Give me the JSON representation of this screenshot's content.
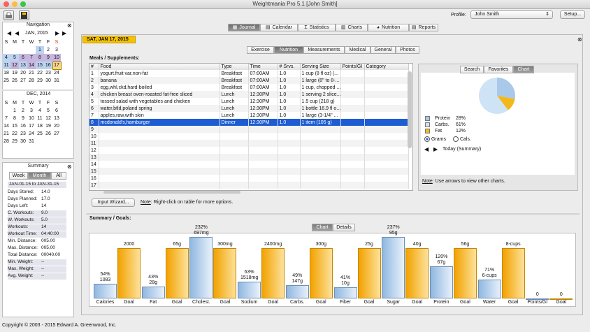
{
  "window": {
    "title": "Weightmania Pro 5.1 [John Smith]"
  },
  "profile": {
    "label": "Profile:",
    "value": "John Smith",
    "setup": "Setup..."
  },
  "nav": {
    "header": "Navigation",
    "month1": "JAN, 2015",
    "month2": "DEC, 2014",
    "weekdays": [
      "S",
      "M",
      "T",
      "W",
      "T",
      "F",
      "S"
    ],
    "jan": [
      [
        "",
        "",
        "",
        "",
        "1",
        "2",
        "3"
      ],
      [
        "4",
        "5",
        "6",
        "7",
        "8",
        "9",
        "10"
      ],
      [
        "11",
        "12",
        "13",
        "14",
        "15",
        "16",
        "17"
      ],
      [
        "18",
        "19",
        "20",
        "21",
        "22",
        "23",
        "24"
      ],
      [
        "25",
        "26",
        "27",
        "28",
        "29",
        "30",
        "31"
      ]
    ],
    "dec": [
      [
        "",
        "1",
        "2",
        "3",
        "4",
        "5",
        "6"
      ],
      [
        "7",
        "8",
        "9",
        "10",
        "11",
        "12",
        "13"
      ],
      [
        "14",
        "15",
        "16",
        "17",
        "18",
        "19",
        "20"
      ],
      [
        "21",
        "22",
        "23",
        "24",
        "25",
        "26",
        "27"
      ],
      [
        "28",
        "29",
        "30",
        "31",
        "",
        "",
        ""
      ]
    ]
  },
  "summary": {
    "header": "Summary",
    "tabs": [
      "Week",
      "Month",
      "All"
    ],
    "range": "JAN-01-15 to JAN-31-15",
    "rows": [
      [
        "Days Stored:",
        "14.0"
      ],
      [
        "Days Planned:",
        "17.0"
      ],
      [
        "Days Left:",
        "14"
      ],
      [
        "C. Workouts:",
        "9.0"
      ],
      [
        "W. Workouts:",
        "5.0"
      ],
      [
        "Workouts:",
        "14"
      ],
      [
        "Workout Time:",
        "04:40:00"
      ],
      [
        "Min. Distance:",
        "005.00"
      ],
      [
        "Max. Distance:",
        "005.00"
      ],
      [
        "Total Distance:",
        "00040.00"
      ],
      [
        "Min. Weight:",
        "--"
      ],
      [
        "Max. Weight:",
        "--"
      ],
      [
        "Avg. Weight:",
        "--"
      ]
    ]
  },
  "main_tabs": [
    "Journal",
    "Calendar",
    "Statistics",
    "Charts",
    "Nutrition",
    "Reports"
  ],
  "date": "SAT, JAN 17, 2015",
  "sub_tabs": [
    "Exercise",
    "Nutrition",
    "Measurements",
    "Medical",
    "General",
    "Photos"
  ],
  "meals": {
    "title": "Meals / Supplements:",
    "headers": [
      "#",
      "Food",
      "Type",
      "Time",
      "# Srvs.",
      "Serving Size",
      "Points/GI",
      "Category"
    ],
    "rows": [
      [
        "1",
        "yogurt,fruit var,non-fat",
        "Breakfast",
        "07:00AM",
        "1.0",
        "1 cup (8 fl oz) (...",
        ""
      ],
      [
        "2",
        "banana",
        "Breakfast",
        "07:00AM",
        "1.0",
        "1 large (8\" to 8-...",
        ""
      ],
      [
        "3",
        "egg,whl,ckd,hard-boiled",
        "Breakfast",
        "07:00AM",
        "1.0",
        "1 cup, chopped ...",
        ""
      ],
      [
        "4",
        "chicken breast oven-roasted fat-free sliced",
        "Lunch",
        "12:30PM",
        "1.0",
        "1 serving 2 slice...",
        ""
      ],
      [
        "5",
        "tossed salad with vegetables and chicken",
        "Lunch",
        "12:30PM",
        "1.0",
        "1.5 cup (218 g)",
        ""
      ],
      [
        "6",
        "water,btld,poland spring",
        "Lunch",
        "12:30PM",
        "1.0",
        "1 bottle 16.9 fl o...",
        ""
      ],
      [
        "7",
        "apples,raw,with skin",
        "Lunch",
        "12:30PM",
        "1.0",
        "1 large (3-1/4\" ...",
        ""
      ],
      [
        "8",
        "mcdonald's,hamburger",
        "Dinner",
        "12:30PM",
        "1.0",
        "1 item (105 g)",
        ""
      ]
    ],
    "empty": [
      "9",
      "10",
      "11",
      "12",
      "13",
      "14",
      "15",
      "16",
      "17"
    ]
  },
  "wizard": "Input Wizard...",
  "note": {
    "bold": "Note",
    "text": ": Right-click on table for more options."
  },
  "right_panel": {
    "tabs": [
      "Search",
      "Favorites",
      "Chart"
    ],
    "legend": [
      {
        "label": "Protein",
        "value": "28%",
        "color": "#a9c8ea"
      },
      {
        "label": "Carbs.",
        "value": "61%",
        "color": "#cfe3f6"
      },
      {
        "label": "Fat",
        "value": "12%",
        "color": "#f3b81c"
      }
    ],
    "radio": [
      "Grams",
      "Cals."
    ],
    "nav_label": "Today (Summary)",
    "note_bold": "Note",
    "note_text": ": Use arrows to view other charts."
  },
  "goals": {
    "title": "Summary / Goals:",
    "tabs": [
      "Chart",
      "Details"
    ]
  },
  "chart_data": {
    "type": "bar",
    "categories": [
      "Calories",
      "Fat",
      "Cholest.",
      "Sodium",
      "Carbs.",
      "Fiber",
      "Sugar",
      "Protein",
      "Water",
      "Points/GI"
    ],
    "series": [
      {
        "values": [
          1083,
          28,
          697,
          1518,
          147,
          10,
          95,
          67,
          6,
          0
        ],
        "labels": [
          "54%|1083",
          "43%|28g",
          "232%|697mg",
          "63%|1518mg",
          "49%|147g",
          "41%|10g",
          "237%|95g",
          "120%|67g",
          "71%|6-cups",
          "0"
        ]
      },
      {
        "values": [
          2000,
          65,
          300,
          2400,
          300,
          25,
          40,
          56,
          8,
          0
        ],
        "labels": [
          "2000",
          "65g",
          "300mg",
          "2400mg",
          "300g",
          "25g",
          "40g",
          "56g",
          "8-cups",
          "0"
        ]
      }
    ],
    "xlabel_pair": "Goal",
    "percents": [
      54,
      43,
      232,
      63,
      49,
      41,
      237,
      120,
      71,
      0
    ]
  },
  "pie": {
    "protein": 28,
    "carbs": 61,
    "fat": 12
  },
  "footer": "Copyright © 2003 - 2015 Edward A. Greenwood, Inc."
}
